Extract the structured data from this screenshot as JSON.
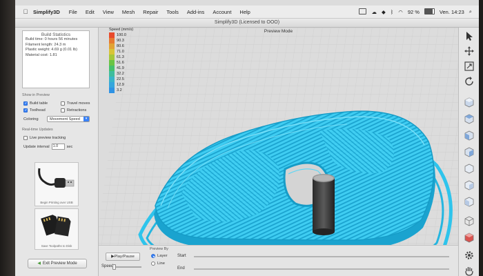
{
  "menubar": {
    "app_name": "Simplify3D",
    "items": [
      "File",
      "Edit",
      "View",
      "Mesh",
      "Repair",
      "Tools",
      "Add-ins",
      "Account",
      "Help"
    ],
    "battery": "92 %",
    "clock": "Ven. 14:23"
  },
  "window": {
    "title": "Simplify3D (Licensed to OOO)"
  },
  "build_stats": {
    "header": "Build Statistics",
    "lines": [
      "Build time: 0 hours 56 minutes",
      "Filament length: 24.3 m",
      "Plastic weight: 4.69 g (0.01 lb)",
      "Material cost: 1.81"
    ]
  },
  "show_in_preview": {
    "label": "Show in Preview",
    "build_table": "Build table",
    "travel_moves": "Travel moves",
    "toolhead": "Toolhead",
    "retractions": "Retractions",
    "coloring_label": "Coloring",
    "coloring_value": "Movement Speed"
  },
  "realtime": {
    "label": "Real-time Updates",
    "live_tracking": "Live preview tracking",
    "interval_label": "Update interval",
    "interval_value": "1.0",
    "interval_unit": "sec"
  },
  "cards": {
    "usb_caption": "Begin Printing over USB",
    "sd_caption": "Save Toolpaths to Disk"
  },
  "exit_button": "Exit Preview Mode",
  "viewport": {
    "title": "Preview Mode",
    "legend_title": "Speed (mm/s)",
    "legend": [
      {
        "value": "100.0",
        "color": "#e84a2c"
      },
      {
        "value": "90.3",
        "color": "#e77a30"
      },
      {
        "value": "80.6",
        "color": "#e2a334"
      },
      {
        "value": "71.0",
        "color": "#d8c437"
      },
      {
        "value": "61.3",
        "color": "#a6c73a"
      },
      {
        "value": "51.6",
        "color": "#6ac444"
      },
      {
        "value": "41.9",
        "color": "#45c06c"
      },
      {
        "value": "32.2",
        "color": "#3fbd9d"
      },
      {
        "value": "22.5",
        "color": "#39b4c8"
      },
      {
        "value": "12.9",
        "color": "#35a6dc"
      },
      {
        "value": "3.2",
        "color": "#2f93e4"
      }
    ],
    "toolpath_color": "#2ec4ec"
  },
  "bottom": {
    "play_pause": "Play/Pause",
    "speed_label": "Speed:",
    "preview_by": "Preview By",
    "layer": "Layer",
    "line": "Line",
    "start": "Start",
    "end": "End"
  }
}
